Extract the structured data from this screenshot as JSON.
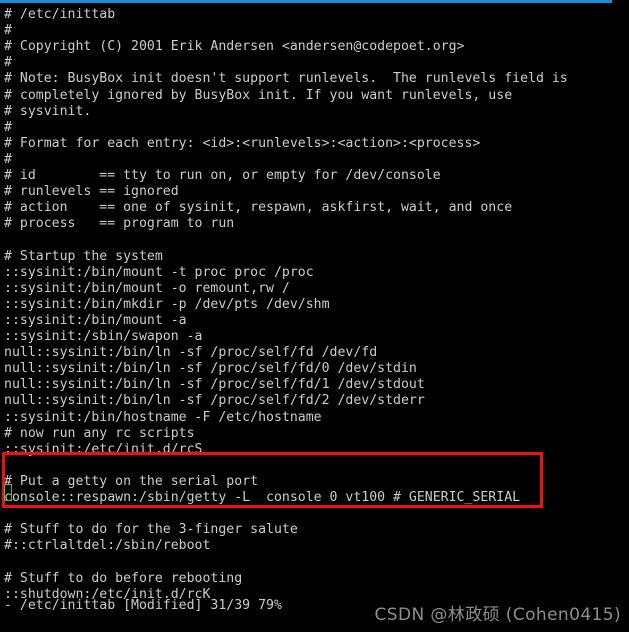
{
  "window": {
    "accent_color": "#1e8bd6",
    "background_color": "#000000",
    "text_color": "#cccccc"
  },
  "editor": {
    "file_path": "/etc/inittab",
    "cursor": {
      "color": "#33d017",
      "line_index": 28,
      "column": 1
    },
    "lines": [
      "# /etc/inittab",
      "#",
      "# Copyright (C) 2001 Erik Andersen <andersen@codepoet.org>",
      "#",
      "# Note: BusyBox init doesn't support runlevels.  The runlevels field is",
      "# completely ignored by BusyBox init. If you want runlevels, use",
      "# sysvinit.",
      "#",
      "# Format for each entry: <id>:<runlevels>:<action>:<process>",
      "#",
      "# id        == tty to run on, or empty for /dev/console",
      "# runlevels == ignored",
      "# action    == one of sysinit, respawn, askfirst, wait, and once",
      "# process   == program to run",
      "",
      "# Startup the system",
      "::sysinit:/bin/mount -t proc proc /proc",
      "::sysinit:/bin/mount -o remount,rw /",
      "::sysinit:/bin/mkdir -p /dev/pts /dev/shm",
      "::sysinit:/bin/mount -a",
      "::sysinit:/sbin/swapon -a",
      "null::sysinit:/bin/ln -sf /proc/self/fd /dev/fd",
      "null::sysinit:/bin/ln -sf /proc/self/fd/0 /dev/stdin",
      "null::sysinit:/bin/ln -sf /proc/self/fd/1 /dev/stdout",
      "null::sysinit:/bin/ln -sf /proc/self/fd/2 /dev/stderr",
      "::sysinit:/bin/hostname -F /etc/hostname",
      "# now run any rc scripts",
      "::sysinit:/etc/init.d/rcS",
      "",
      "# Put a getty on the serial port",
      "console::respawn:/sbin/getty -L  console 0 vt100 # GENERIC_SERIAL",
      "",
      "# Stuff to do for the 3-finger salute",
      "#::ctrlaltdel:/sbin/reboot",
      "",
      "# Stuff to do before rebooting",
      "::shutdown:/etc/init.d/rcK"
    ]
  },
  "annotation": {
    "color": "#ee1111",
    "shape": "rectangle",
    "covers_lines": [
      "# Put a getty on the serial port",
      "console::respawn:/sbin/getty -L  console 0 vt100 # GENERIC_SERIAL"
    ]
  },
  "status_bar": {
    "text": "- /etc/inittab [Modified] 31/39 79%",
    "file": "/etc/inittab",
    "modified_flag": "[Modified]",
    "position": "31/39",
    "percent": "79%"
  },
  "watermark": {
    "text": "CSDN @林政硕 (Cohen0415)"
  }
}
